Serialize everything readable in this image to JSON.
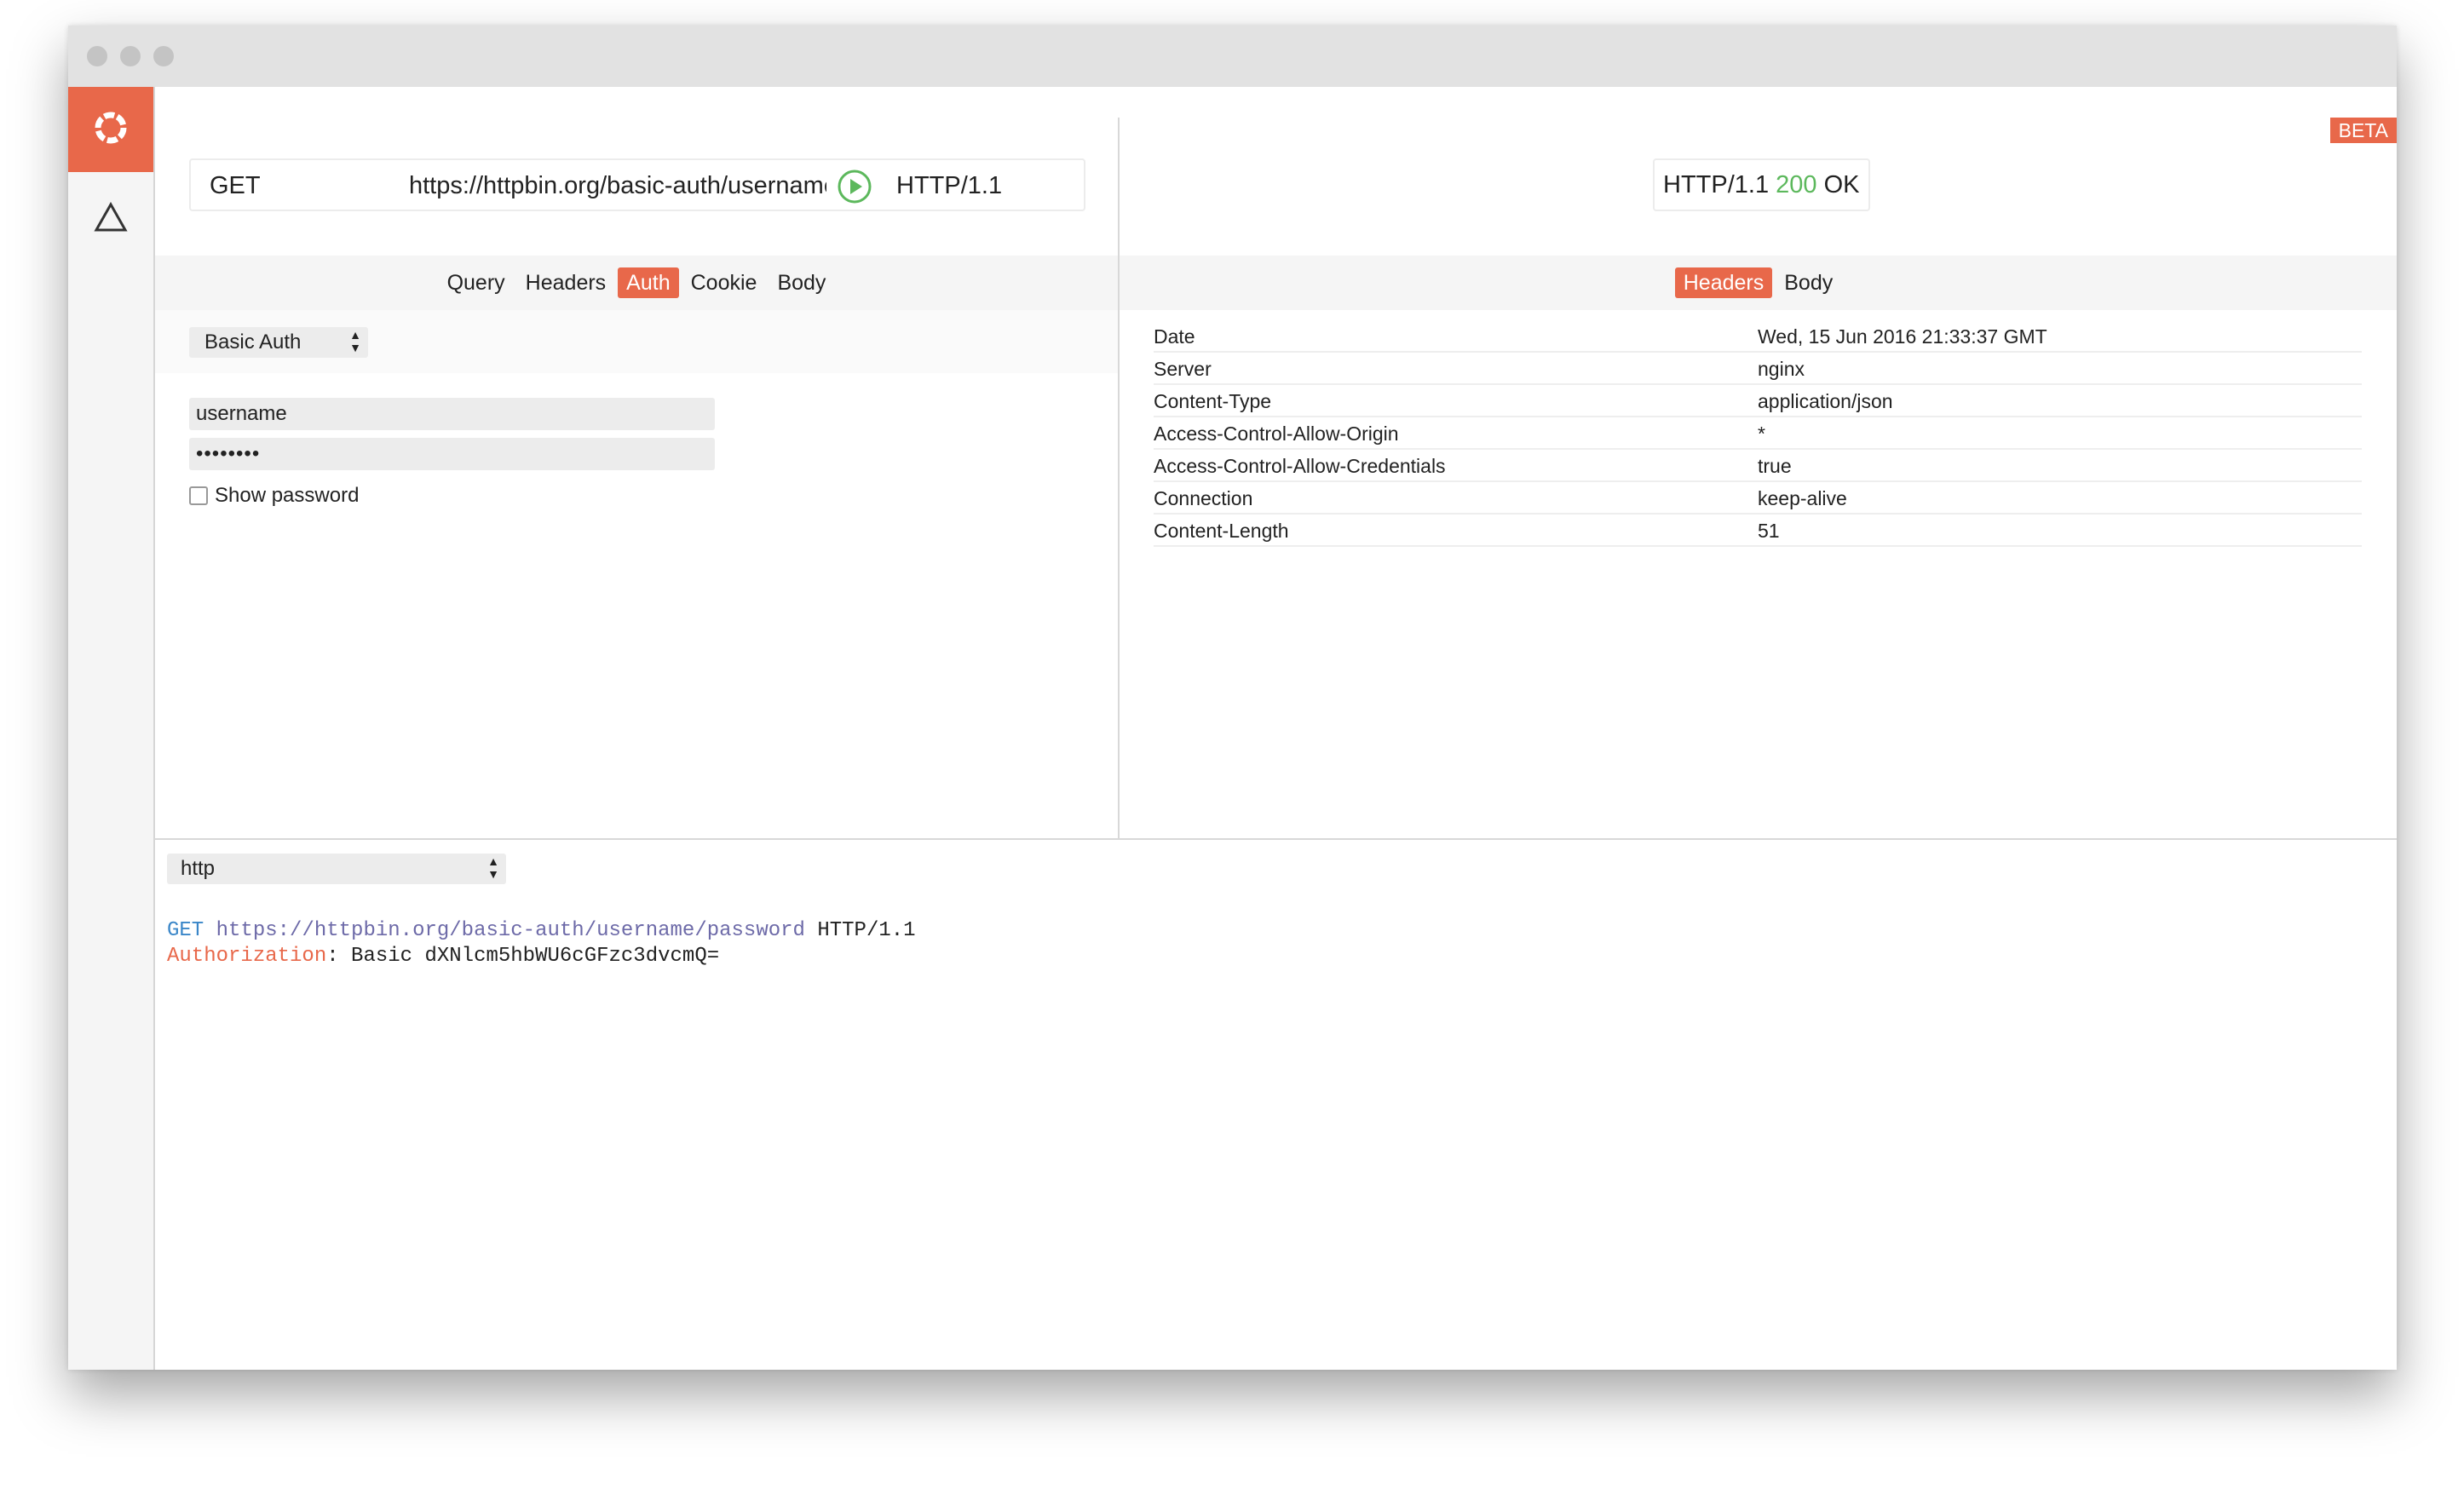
{
  "app": {
    "beta_label": "BETA",
    "accent_color": "#e8684a",
    "success_color": "#5cb85c"
  },
  "sidebar": {
    "items": [
      {
        "icon": "lifebuoy-logo-icon",
        "active": true
      },
      {
        "icon": "triangle-icon",
        "active": false
      }
    ]
  },
  "request": {
    "method": "GET",
    "url": "https://httpbin.org/basic-auth/username/password",
    "protocol": "HTTP/1.1",
    "tabs": [
      "Query",
      "Headers",
      "Auth",
      "Cookie",
      "Body"
    ],
    "active_tab": "Auth",
    "auth": {
      "type": "Basic Auth",
      "username": "username",
      "password_mask": "••••••••",
      "show_password_label": "Show password",
      "show_password_checked": false
    }
  },
  "response": {
    "protocol": "HTTP/1.1",
    "status_code": "200",
    "status_text": "OK",
    "tabs": [
      "Headers",
      "Body"
    ],
    "active_tab": "Headers",
    "headers": [
      {
        "name": "Date",
        "value": "Wed, 15 Jun 2016 21:33:37 GMT"
      },
      {
        "name": "Server",
        "value": "nginx"
      },
      {
        "name": "Content-Type",
        "value": "application/json"
      },
      {
        "name": "Access-Control-Allow-Origin",
        "value": "*"
      },
      {
        "name": "Access-Control-Allow-Credentials",
        "value": "true"
      },
      {
        "name": "Connection",
        "value": "keep-alive"
      },
      {
        "name": "Content-Length",
        "value": "51"
      }
    ]
  },
  "preview": {
    "language": "http",
    "line1": {
      "method": "GET",
      "url": "https://httpbin.org/basic-auth/username/password",
      "protocol": "HTTP/1.1"
    },
    "line2": {
      "key": "Authorization",
      "separator": ":",
      "value": "Basic dXNlcm5hbWU6cGFzc3dvcmQ="
    }
  }
}
